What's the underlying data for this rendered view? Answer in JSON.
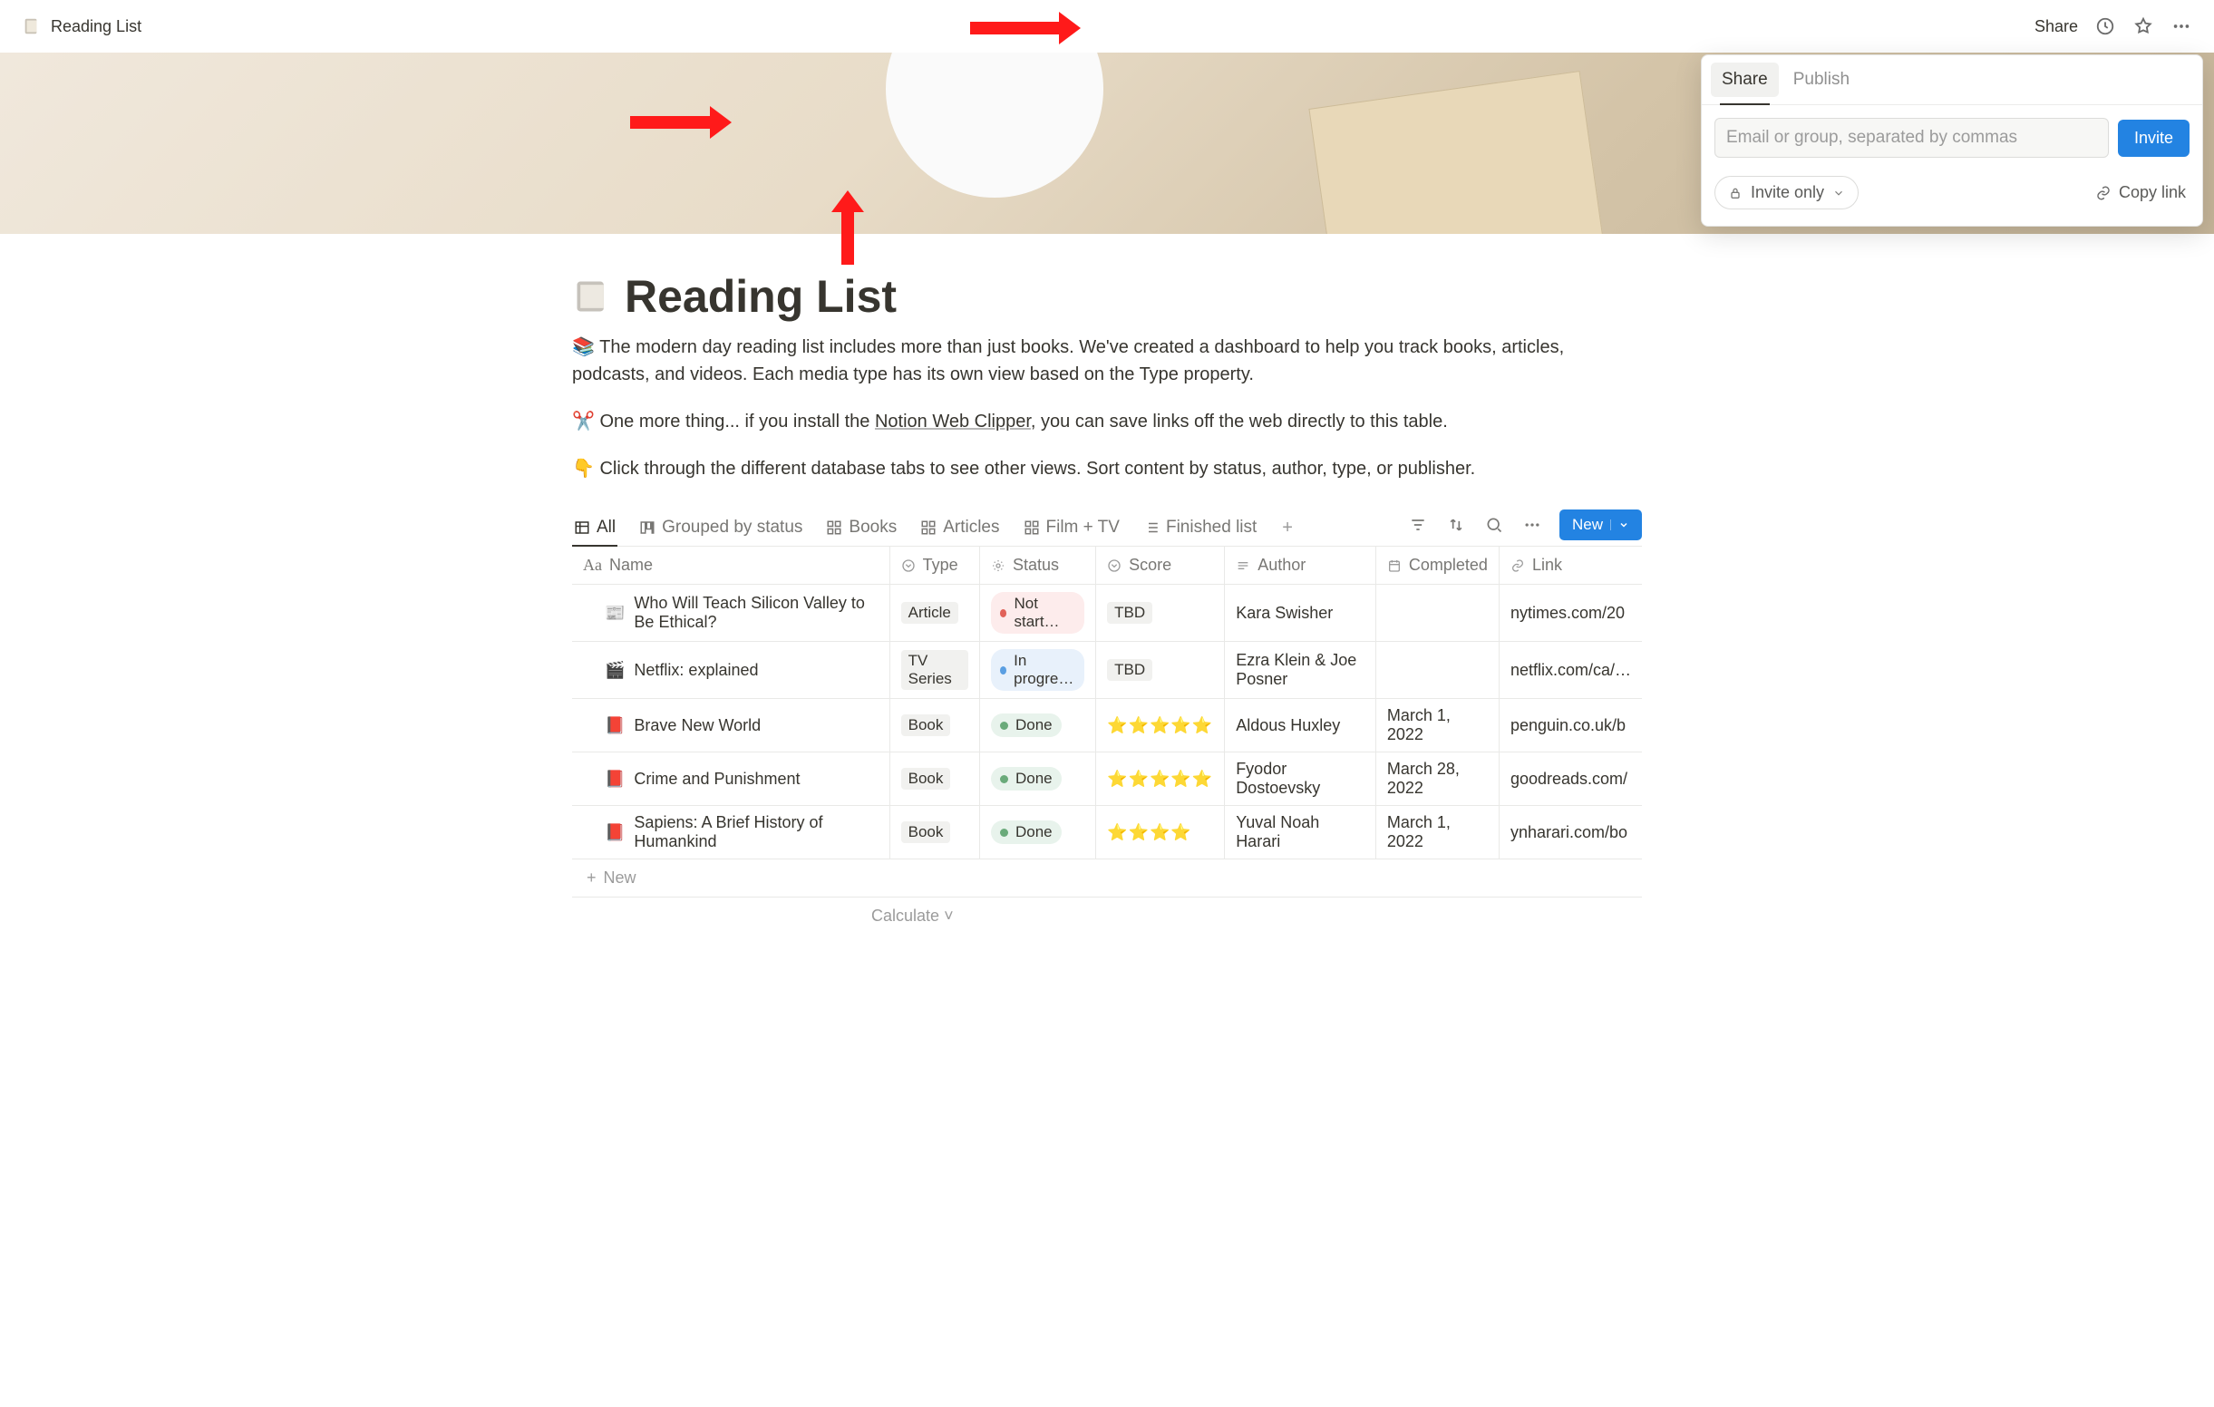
{
  "topbar": {
    "title": "Reading List",
    "share_label": "Share"
  },
  "share_panel": {
    "tabs": {
      "share": "Share",
      "publish": "Publish"
    },
    "input_placeholder": "Email or group, separated by commas",
    "invite_label": "Invite",
    "access_label": "Invite only",
    "copy_link_label": "Copy link"
  },
  "page": {
    "icon": "📖",
    "title": "Reading List",
    "desc_emoji": "📚",
    "desc1": " The modern day reading list includes more than just books. We've created a dashboard to help you track books, articles, podcasts, and videos. Each media type has its own view based on the Type property.",
    "scissors": "✂️",
    "desc2_pre": " One more thing... if you install the ",
    "clipper_link": "Notion Web Clipper",
    "desc2_post": ", you can save links off the web directly to this table.",
    "point": "👇",
    "desc3": " Click through the different database tabs to see other views. Sort content by status, author, type, or publisher."
  },
  "views": {
    "all": "All",
    "grouped": "Grouped by status",
    "books": "Books",
    "articles": "Articles",
    "film": "Film + TV",
    "finished": "Finished list"
  },
  "toolbar": {
    "new_label": "New"
  },
  "columns": {
    "name": "Name",
    "type": "Type",
    "status": "Status",
    "score": "Score",
    "author": "Author",
    "completed": "Completed",
    "link": "Link"
  },
  "rows": [
    {
      "icon": "📰",
      "name": "Who Will Teach Silicon Valley to Be Ethical?",
      "type": "Article",
      "status_class": "not",
      "status": "Not start…",
      "score": "TBD",
      "score_type": "tag",
      "author": "Kara Swisher",
      "completed": "",
      "link": "nytimes.com/20"
    },
    {
      "icon": "🎬",
      "name": "Netflix: explained",
      "type": "TV Series",
      "status_class": "prog",
      "status": "In progre…",
      "score": "TBD",
      "score_type": "tag",
      "author": "Ezra Klein & Joe Posner",
      "completed": "",
      "link": "netflix.com/ca/…"
    },
    {
      "icon": "📕",
      "name": "Brave New World",
      "type": "Book",
      "status_class": "done",
      "status": "Done",
      "score": "⭐⭐⭐⭐⭐",
      "score_type": "stars",
      "author": "Aldous Huxley",
      "completed": "March 1, 2022",
      "link": "penguin.co.uk/b"
    },
    {
      "icon": "📕",
      "name": "Crime and Punishment",
      "type": "Book",
      "status_class": "done",
      "status": "Done",
      "score": "⭐⭐⭐⭐⭐",
      "score_type": "stars",
      "author": "Fyodor Dostoevsky",
      "completed": "March 28, 2022",
      "link": "goodreads.com/"
    },
    {
      "icon": "📕",
      "name": "Sapiens: A Brief History of Humankind",
      "type": "Book",
      "status_class": "done",
      "status": "Done",
      "score": "⭐⭐⭐⭐",
      "score_type": "stars",
      "author": "Yuval Noah Harari",
      "completed": "March 1, 2022",
      "link": "ynharari.com/bo"
    }
  ],
  "new_row_label": "New",
  "calculate_label": "Calculate"
}
